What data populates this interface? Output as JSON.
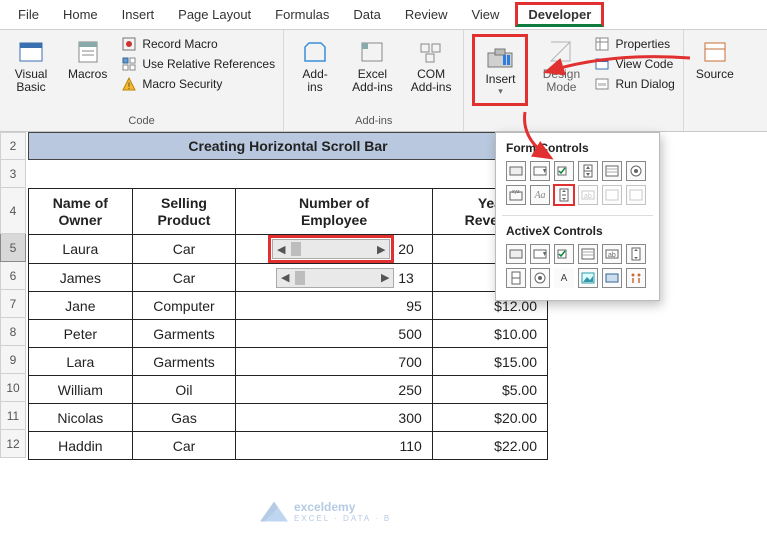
{
  "tabs": {
    "file": "File",
    "home": "Home",
    "insert": "Insert",
    "pagelayout": "Page Layout",
    "formulas": "Formulas",
    "data": "Data",
    "review": "Review",
    "view": "View",
    "developer": "Developer"
  },
  "ribbon": {
    "code": {
      "visual_basic": "Visual\nBasic",
      "macros": "Macros",
      "record_macro": "Record Macro",
      "use_rel_refs": "Use Relative References",
      "macro_security": "Macro Security",
      "group_label": "Code"
    },
    "addins": {
      "addins": "Add-\nins",
      "excel_addins": "Excel\nAdd-ins",
      "com_addins": "COM\nAdd-ins",
      "group_label": "Add-ins"
    },
    "controls": {
      "insert": "Insert",
      "design_mode": "Design\nMode",
      "properties": "Properties",
      "view_code": "View Code",
      "run_dialog": "Run Dialog"
    },
    "source": "Source"
  },
  "dropdown": {
    "form_title": "Form Controls",
    "activex_title": "ActiveX Controls"
  },
  "sheet_title": "Creating Horizontal Scroll Bar",
  "row_numbers": [
    "2",
    "3",
    "4",
    "5",
    "6",
    "7",
    "8",
    "9",
    "10",
    "11",
    "12"
  ],
  "headers": {
    "owner": "Name of\nOwner",
    "product": "Selling\nProduct",
    "employee": "Number of\nEmployee",
    "revenue": "Yea\nRevenu"
  },
  "scroll_values": {
    "r5": "20",
    "r6": "13"
  },
  "rows": [
    {
      "owner": "Laura",
      "product": "Car",
      "emp": "20",
      "rev": "$10"
    },
    {
      "owner": "James",
      "product": "Car",
      "emp": "13",
      "rev": "$20."
    },
    {
      "owner": "Jane",
      "product": "Computer",
      "emp": "95",
      "rev": "$12.00"
    },
    {
      "owner": "Peter",
      "product": "Garments",
      "emp": "500",
      "rev": "$10.00"
    },
    {
      "owner": "Lara",
      "product": "Garments",
      "emp": "700",
      "rev": "$15.00"
    },
    {
      "owner": "William",
      "product": "Oil",
      "emp": "250",
      "rev": "$5.00"
    },
    {
      "owner": "Nicolas",
      "product": "Gas",
      "emp": "300",
      "rev": "$20.00"
    },
    {
      "owner": "Haddin",
      "product": "Car",
      "emp": "110",
      "rev": "$22.00"
    }
  ],
  "watermark": {
    "brand": "exceldemy",
    "sub": "EXCEL · DATA · B"
  }
}
